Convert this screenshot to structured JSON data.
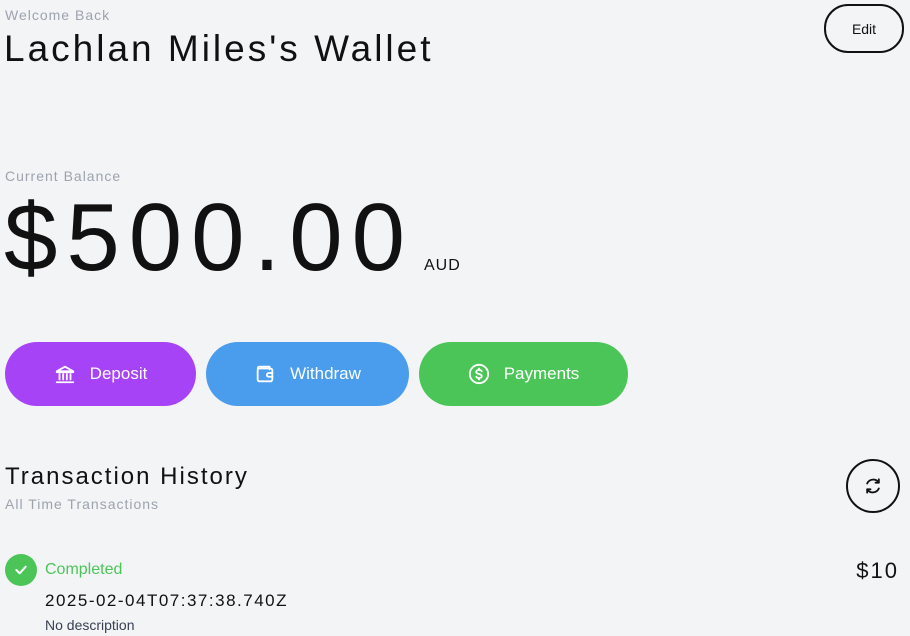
{
  "header": {
    "welcome": "Welcome Back",
    "title": "Lachlan Miles's Wallet",
    "edit_label": "Edit"
  },
  "balance": {
    "label": "Current Balance",
    "amount": "$500.00",
    "currency": "AUD"
  },
  "actions": [
    {
      "label": "Deposit",
      "icon": "bank-icon",
      "color": "#a743f7"
    },
    {
      "label": "Withdraw",
      "icon": "wallet-icon",
      "color": "#4a9ced"
    },
    {
      "label": "Payments",
      "icon": "dollar-circle-icon",
      "color": "#4cc558"
    }
  ],
  "history": {
    "title": "Transaction History",
    "subtitle": "All Time Transactions",
    "refresh_icon": "refresh-icon",
    "transactions": [
      {
        "status": "Completed",
        "status_color": "#4cc558",
        "date": "2025-02-04T07:37:38.740Z",
        "description": "No description",
        "amount": "$10"
      }
    ]
  }
}
